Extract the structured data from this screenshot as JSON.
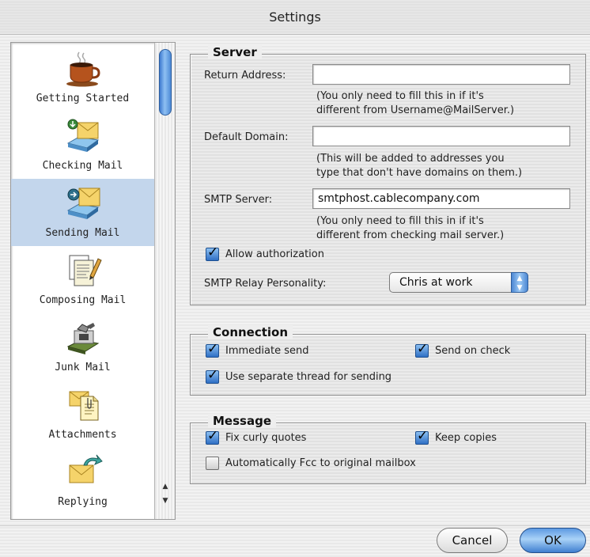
{
  "window": {
    "title": "Settings"
  },
  "sidebar": {
    "items": [
      {
        "label": "Getting Started",
        "icon": "coffee-cup-icon",
        "selected": false
      },
      {
        "label": "Checking Mail",
        "icon": "checking-mail-icon",
        "selected": true
      },
      {
        "label": "Sending Mail",
        "icon": "sending-mail-icon",
        "selected": true
      },
      {
        "label": "Composing Mail",
        "icon": "composing-mail-icon",
        "selected": false
      },
      {
        "label": "Junk Mail",
        "icon": "junk-mail-icon",
        "selected": false
      },
      {
        "label": "Attachments",
        "icon": "attachments-icon",
        "selected": false
      },
      {
        "label": "Replying",
        "icon": "replying-icon",
        "selected": false
      }
    ],
    "scroll_up_icon": "scroll-up-arrow-icon",
    "scroll_down_icon": "scroll-down-arrow-icon"
  },
  "server": {
    "title": "Server",
    "return_address": {
      "label": "Return Address:",
      "value": ""
    },
    "return_hint_1": "(You only need to fill this in if it's",
    "return_hint_2": "different from Username@MailServer.)",
    "default_domain": {
      "label": "Default Domain:",
      "value": ""
    },
    "domain_hint_1": "(This will be added to addresses you",
    "domain_hint_2": "type that don't have domains on them.)",
    "smtp_server": {
      "label": "SMTP Server:",
      "value": "smtphost.cablecompany.com"
    },
    "smtp_hint_1": "(You only need to fill this in if it's",
    "smtp_hint_2": "different from checking mail server.)",
    "allow_auth": {
      "label": "Allow authorization",
      "checked": true
    },
    "relay": {
      "label": "SMTP Relay Personality:",
      "value": "Chris at work"
    }
  },
  "connection": {
    "title": "Connection",
    "immediate_send": {
      "label": "Immediate send",
      "checked": true
    },
    "send_on_check": {
      "label": "Send on check",
      "checked": true
    },
    "separate_thread": {
      "label": "Use separate thread for sending",
      "checked": true
    }
  },
  "message": {
    "title": "Message",
    "fix_curly": {
      "label": "Fix curly quotes",
      "checked": true
    },
    "keep_copies": {
      "label": "Keep copies",
      "checked": true
    },
    "auto_fcc": {
      "label": "Automatically Fcc to original mailbox",
      "checked": false
    }
  },
  "buttons": {
    "cancel": "Cancel",
    "ok": "OK"
  },
  "colors": {
    "selection": "#c3d6ec",
    "accent": "#3f7fd0"
  }
}
